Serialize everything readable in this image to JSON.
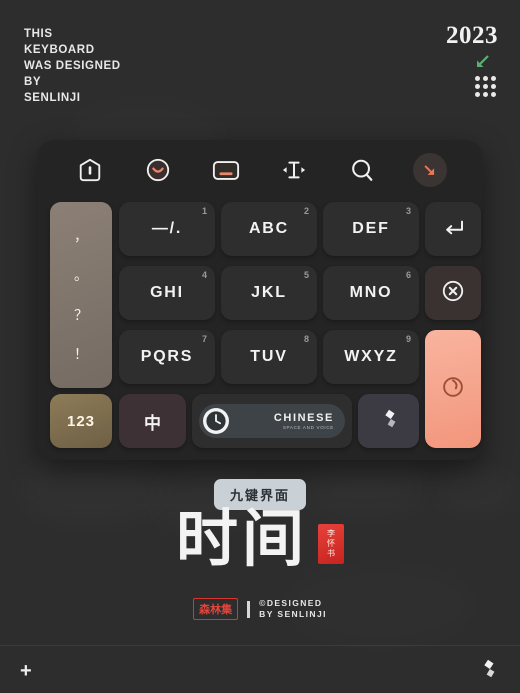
{
  "header": {
    "tagline_lines": [
      "THIS",
      "KEYBOARD",
      "WAS DESIGNED",
      "BY",
      "SENLINJI"
    ],
    "year": "2023",
    "arrow_icon": "arrow-down-left-icon",
    "arrow_color": "#5fae71",
    "grid_icon": "dot-grid-icon"
  },
  "toolbar": {
    "items": [
      {
        "name": "home-icon",
        "label": "home"
      },
      {
        "name": "emoji-icon",
        "label": "emoji"
      },
      {
        "name": "keyboard-icon",
        "label": "keyboard"
      },
      {
        "name": "cursor-text-icon",
        "label": "cursor"
      },
      {
        "name": "search-icon",
        "label": "search"
      },
      {
        "name": "collapse-icon",
        "label": "collapse"
      }
    ],
    "accent_color": "#e8876a"
  },
  "keyboard": {
    "punctuation": [
      "，",
      "。",
      "？",
      "！"
    ],
    "keys": [
      {
        "label": "—/.",
        "num": "1"
      },
      {
        "label": "ABC",
        "num": "2"
      },
      {
        "label": "DEF",
        "num": "3"
      },
      {
        "label": "GHI",
        "num": "4"
      },
      {
        "label": "JKL",
        "num": "5"
      },
      {
        "label": "MNO",
        "num": "6"
      },
      {
        "label": "PQRS",
        "num": "7"
      },
      {
        "label": "TUV",
        "num": "8"
      },
      {
        "label": "WXYZ",
        "num": "9"
      }
    ],
    "enter_key": {
      "name": "return-icon",
      "label": "return"
    },
    "delete_key": {
      "name": "delete-circle-icon",
      "label": "delete"
    },
    "numeric_key": {
      "label": "123"
    },
    "language_key": {
      "label": "中"
    },
    "space_key": {
      "primary": "CHINESE",
      "secondary": "SPACE AND VOICE",
      "icon": "clock-icon"
    },
    "emoji_key": {
      "name": "sticker-icon",
      "label": "sticker"
    },
    "send_key": {
      "name": "voice-circle-icon",
      "label": "voice",
      "color": "#f5a58f"
    }
  },
  "footer": {
    "badge": "九键界面",
    "title": "时间",
    "seal_chars": [
      "李",
      "怀",
      "书"
    ],
    "stamp": "森林集",
    "credit_line1": "©DESIGNED",
    "credit_line2": "BY SENLINJI",
    "add_icon": "plus-icon",
    "brand_icon": "sticker-logo-icon"
  }
}
